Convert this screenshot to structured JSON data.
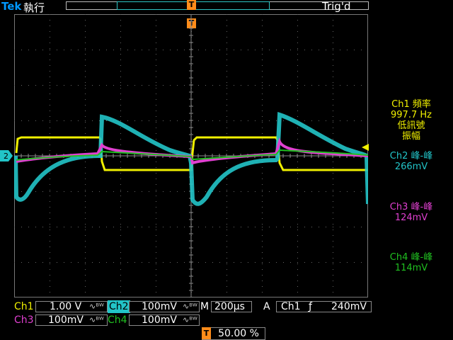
{
  "header": {
    "brand": "Tek",
    "mode": "執行",
    "trigger_status": "Trig'd",
    "trigger_marker_label": "T"
  },
  "channels": {
    "ch1": {
      "label": "Ch1",
      "scale": "1.00 V",
      "coupling_glyph": "∿ᴮᵂ",
      "color": "#f0f000"
    },
    "ch2": {
      "label": "Ch2",
      "scale": "100mV",
      "coupling_glyph": "∿ᴮᵂ",
      "color": "#22c4c8"
    },
    "ch3": {
      "label": "Ch3",
      "scale": "100mV",
      "coupling_glyph": "∿ᴮᵂ",
      "color": "#e040d0"
    },
    "ch4": {
      "label": "Ch4",
      "scale": "100mV",
      "coupling_glyph": "∿ᴮᵂ",
      "color": "#20c020"
    }
  },
  "timebase": {
    "label": "M",
    "value": "200µs"
  },
  "trigger": {
    "type_label": "A",
    "source": "Ch1",
    "slope_glyph": "ƒ",
    "level": "240mV",
    "position_percent": "50.00 %"
  },
  "ch2_marker": "2",
  "measurements": [
    {
      "line1": "Ch1 頻率",
      "line2": "997.7 Hz",
      "line3": "低訊號",
      "line4": "振幅",
      "color": "#f0f000"
    },
    {
      "line1": "Ch2 峰-峰",
      "line2": "266mV",
      "color": "#22c4c8"
    },
    {
      "line1": "Ch3 峰-峰",
      "line2": "124mV",
      "color": "#e040d0"
    },
    {
      "line1": "Ch4 峰-峰",
      "line2": "114mV",
      "color": "#20c020"
    }
  ]
}
